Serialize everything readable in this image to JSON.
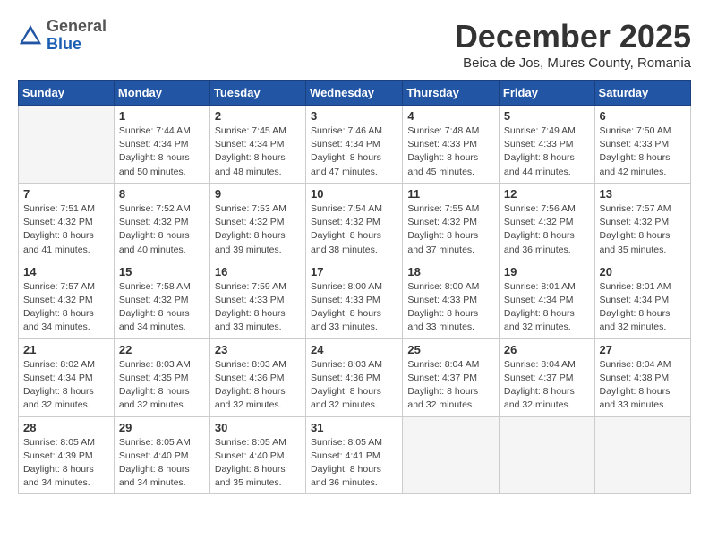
{
  "logo": {
    "general": "General",
    "blue": "Blue"
  },
  "header": {
    "month": "December 2025",
    "location": "Beica de Jos, Mures County, Romania"
  },
  "days_of_week": [
    "Sunday",
    "Monday",
    "Tuesday",
    "Wednesday",
    "Thursday",
    "Friday",
    "Saturday"
  ],
  "weeks": [
    [
      {
        "day": "",
        "info": ""
      },
      {
        "day": "1",
        "info": "Sunrise: 7:44 AM\nSunset: 4:34 PM\nDaylight: 8 hours\nand 50 minutes."
      },
      {
        "day": "2",
        "info": "Sunrise: 7:45 AM\nSunset: 4:34 PM\nDaylight: 8 hours\nand 48 minutes."
      },
      {
        "day": "3",
        "info": "Sunrise: 7:46 AM\nSunset: 4:34 PM\nDaylight: 8 hours\nand 47 minutes."
      },
      {
        "day": "4",
        "info": "Sunrise: 7:48 AM\nSunset: 4:33 PM\nDaylight: 8 hours\nand 45 minutes."
      },
      {
        "day": "5",
        "info": "Sunrise: 7:49 AM\nSunset: 4:33 PM\nDaylight: 8 hours\nand 44 minutes."
      },
      {
        "day": "6",
        "info": "Sunrise: 7:50 AM\nSunset: 4:33 PM\nDaylight: 8 hours\nand 42 minutes."
      }
    ],
    [
      {
        "day": "7",
        "info": "Sunrise: 7:51 AM\nSunset: 4:32 PM\nDaylight: 8 hours\nand 41 minutes."
      },
      {
        "day": "8",
        "info": "Sunrise: 7:52 AM\nSunset: 4:32 PM\nDaylight: 8 hours\nand 40 minutes."
      },
      {
        "day": "9",
        "info": "Sunrise: 7:53 AM\nSunset: 4:32 PM\nDaylight: 8 hours\nand 39 minutes."
      },
      {
        "day": "10",
        "info": "Sunrise: 7:54 AM\nSunset: 4:32 PM\nDaylight: 8 hours\nand 38 minutes."
      },
      {
        "day": "11",
        "info": "Sunrise: 7:55 AM\nSunset: 4:32 PM\nDaylight: 8 hours\nand 37 minutes."
      },
      {
        "day": "12",
        "info": "Sunrise: 7:56 AM\nSunset: 4:32 PM\nDaylight: 8 hours\nand 36 minutes."
      },
      {
        "day": "13",
        "info": "Sunrise: 7:57 AM\nSunset: 4:32 PM\nDaylight: 8 hours\nand 35 minutes."
      }
    ],
    [
      {
        "day": "14",
        "info": "Sunrise: 7:57 AM\nSunset: 4:32 PM\nDaylight: 8 hours\nand 34 minutes."
      },
      {
        "day": "15",
        "info": "Sunrise: 7:58 AM\nSunset: 4:32 PM\nDaylight: 8 hours\nand 34 minutes."
      },
      {
        "day": "16",
        "info": "Sunrise: 7:59 AM\nSunset: 4:33 PM\nDaylight: 8 hours\nand 33 minutes."
      },
      {
        "day": "17",
        "info": "Sunrise: 8:00 AM\nSunset: 4:33 PM\nDaylight: 8 hours\nand 33 minutes."
      },
      {
        "day": "18",
        "info": "Sunrise: 8:00 AM\nSunset: 4:33 PM\nDaylight: 8 hours\nand 33 minutes."
      },
      {
        "day": "19",
        "info": "Sunrise: 8:01 AM\nSunset: 4:34 PM\nDaylight: 8 hours\nand 32 minutes."
      },
      {
        "day": "20",
        "info": "Sunrise: 8:01 AM\nSunset: 4:34 PM\nDaylight: 8 hours\nand 32 minutes."
      }
    ],
    [
      {
        "day": "21",
        "info": "Sunrise: 8:02 AM\nSunset: 4:34 PM\nDaylight: 8 hours\nand 32 minutes."
      },
      {
        "day": "22",
        "info": "Sunrise: 8:03 AM\nSunset: 4:35 PM\nDaylight: 8 hours\nand 32 minutes."
      },
      {
        "day": "23",
        "info": "Sunrise: 8:03 AM\nSunset: 4:36 PM\nDaylight: 8 hours\nand 32 minutes."
      },
      {
        "day": "24",
        "info": "Sunrise: 8:03 AM\nSunset: 4:36 PM\nDaylight: 8 hours\nand 32 minutes."
      },
      {
        "day": "25",
        "info": "Sunrise: 8:04 AM\nSunset: 4:37 PM\nDaylight: 8 hours\nand 32 minutes."
      },
      {
        "day": "26",
        "info": "Sunrise: 8:04 AM\nSunset: 4:37 PM\nDaylight: 8 hours\nand 32 minutes."
      },
      {
        "day": "27",
        "info": "Sunrise: 8:04 AM\nSunset: 4:38 PM\nDaylight: 8 hours\nand 33 minutes."
      }
    ],
    [
      {
        "day": "28",
        "info": "Sunrise: 8:05 AM\nSunset: 4:39 PM\nDaylight: 8 hours\nand 34 minutes."
      },
      {
        "day": "29",
        "info": "Sunrise: 8:05 AM\nSunset: 4:40 PM\nDaylight: 8 hours\nand 34 minutes."
      },
      {
        "day": "30",
        "info": "Sunrise: 8:05 AM\nSunset: 4:40 PM\nDaylight: 8 hours\nand 35 minutes."
      },
      {
        "day": "31",
        "info": "Sunrise: 8:05 AM\nSunset: 4:41 PM\nDaylight: 8 hours\nand 36 minutes."
      },
      {
        "day": "",
        "info": ""
      },
      {
        "day": "",
        "info": ""
      },
      {
        "day": "",
        "info": ""
      }
    ]
  ]
}
